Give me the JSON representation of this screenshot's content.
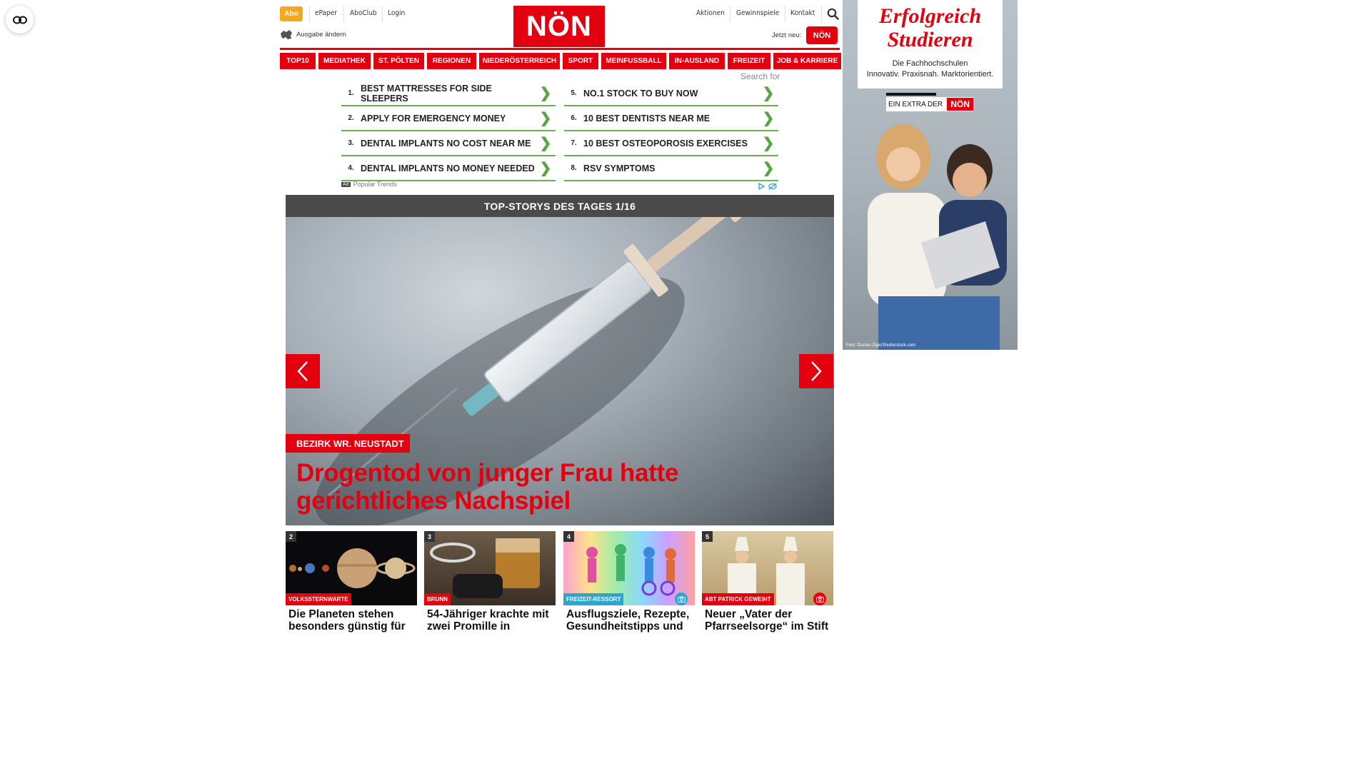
{
  "header": {
    "abo": "Abo",
    "links_left": [
      "ePaper",
      "AboClub",
      "Login"
    ],
    "links_right": [
      "Aktionen",
      "Gewinnspiele",
      "Kontakt"
    ],
    "edition_change": "Ausgabe ändern",
    "logo": "NÖN",
    "new_now": "Jetzt neu:"
  },
  "nav": [
    "TOP10",
    "MEDIATHEK",
    "ST. PÖLTEN",
    "REGIONEN",
    "NIEDERÖSTERREICH",
    "SPORT",
    "MEINFUSSBALL",
    "IN-AUSLAND",
    "FREIZEIT",
    "JOB & KARRIERE"
  ],
  "search_label": "Search for",
  "ad_links": {
    "left": [
      {
        "num": "1.",
        "text": "BEST MATTRESSES FOR SIDE SLEEPERS"
      },
      {
        "num": "2.",
        "text": "APPLY FOR EMERGENCY MONEY"
      },
      {
        "num": "3.",
        "text": "DENTAL IMPLANTS NO COST NEAR ME"
      },
      {
        "num": "4.",
        "text": "DENTAL IMPLANTS NO MONEY NEEDED"
      }
    ],
    "right": [
      {
        "num": "5.",
        "text": "NO.1 STOCK TO BUY NOW"
      },
      {
        "num": "6.",
        "text": "10 BEST DENTISTS NEAR ME"
      },
      {
        "num": "7.",
        "text": "10 BEST OSTEOPOROSIS EXERCISES"
      },
      {
        "num": "8.",
        "text": "RSV SYMPTOMS"
      }
    ],
    "footer_badge": "Ad",
    "footer_text": "Popular Trends"
  },
  "top_stories": {
    "header": "TOP-STORYS DES TAGES 1/16",
    "kicker": "BEZIRK WR. NEUSTADT",
    "headline": "Drogentod von junger Frau hatte gerichtliches Nachspiel"
  },
  "cards": [
    {
      "num": "2",
      "tag": "VOLKSSTERNWARTE",
      "title": "Die Planeten stehen besonders günstig für"
    },
    {
      "num": "3",
      "tag": "BRUNN",
      "title": "54-Jähriger krachte mit zwei Promille in"
    },
    {
      "num": "4",
      "tag": "FREIZEIT-RESSORT",
      "title": "Ausflugsziele, Rezepte, Gesundheitstipps und"
    },
    {
      "num": "5",
      "tag": "ABT PATRICK GEWEIHT",
      "title": "Neuer „Vater der Pfarrseelsorge“ im Stift"
    }
  ],
  "side_ad": {
    "title_line1": "Erfolgreich",
    "title_line2": "Studieren",
    "sub_line1": "Die Fachhochschulen",
    "sub_line2": "Innovativ. Praxisnah. Marktorientiert.",
    "extra_label": "EIN EXTRA DER",
    "extra_logo": "NÖN",
    "photo_credit": "Foto: Drazen Zigic/Shutterstock.com"
  },
  "colors": {
    "brand_red": "#e3000f",
    "abo_orange": "#f5a623",
    "ad_green": "#6ab04c"
  },
  "icons": [
    "eyes-icon",
    "search-icon",
    "map-icon",
    "chevron-left-icon",
    "chevron-right-icon",
    "camera-icon",
    "adchoices-icon"
  ]
}
